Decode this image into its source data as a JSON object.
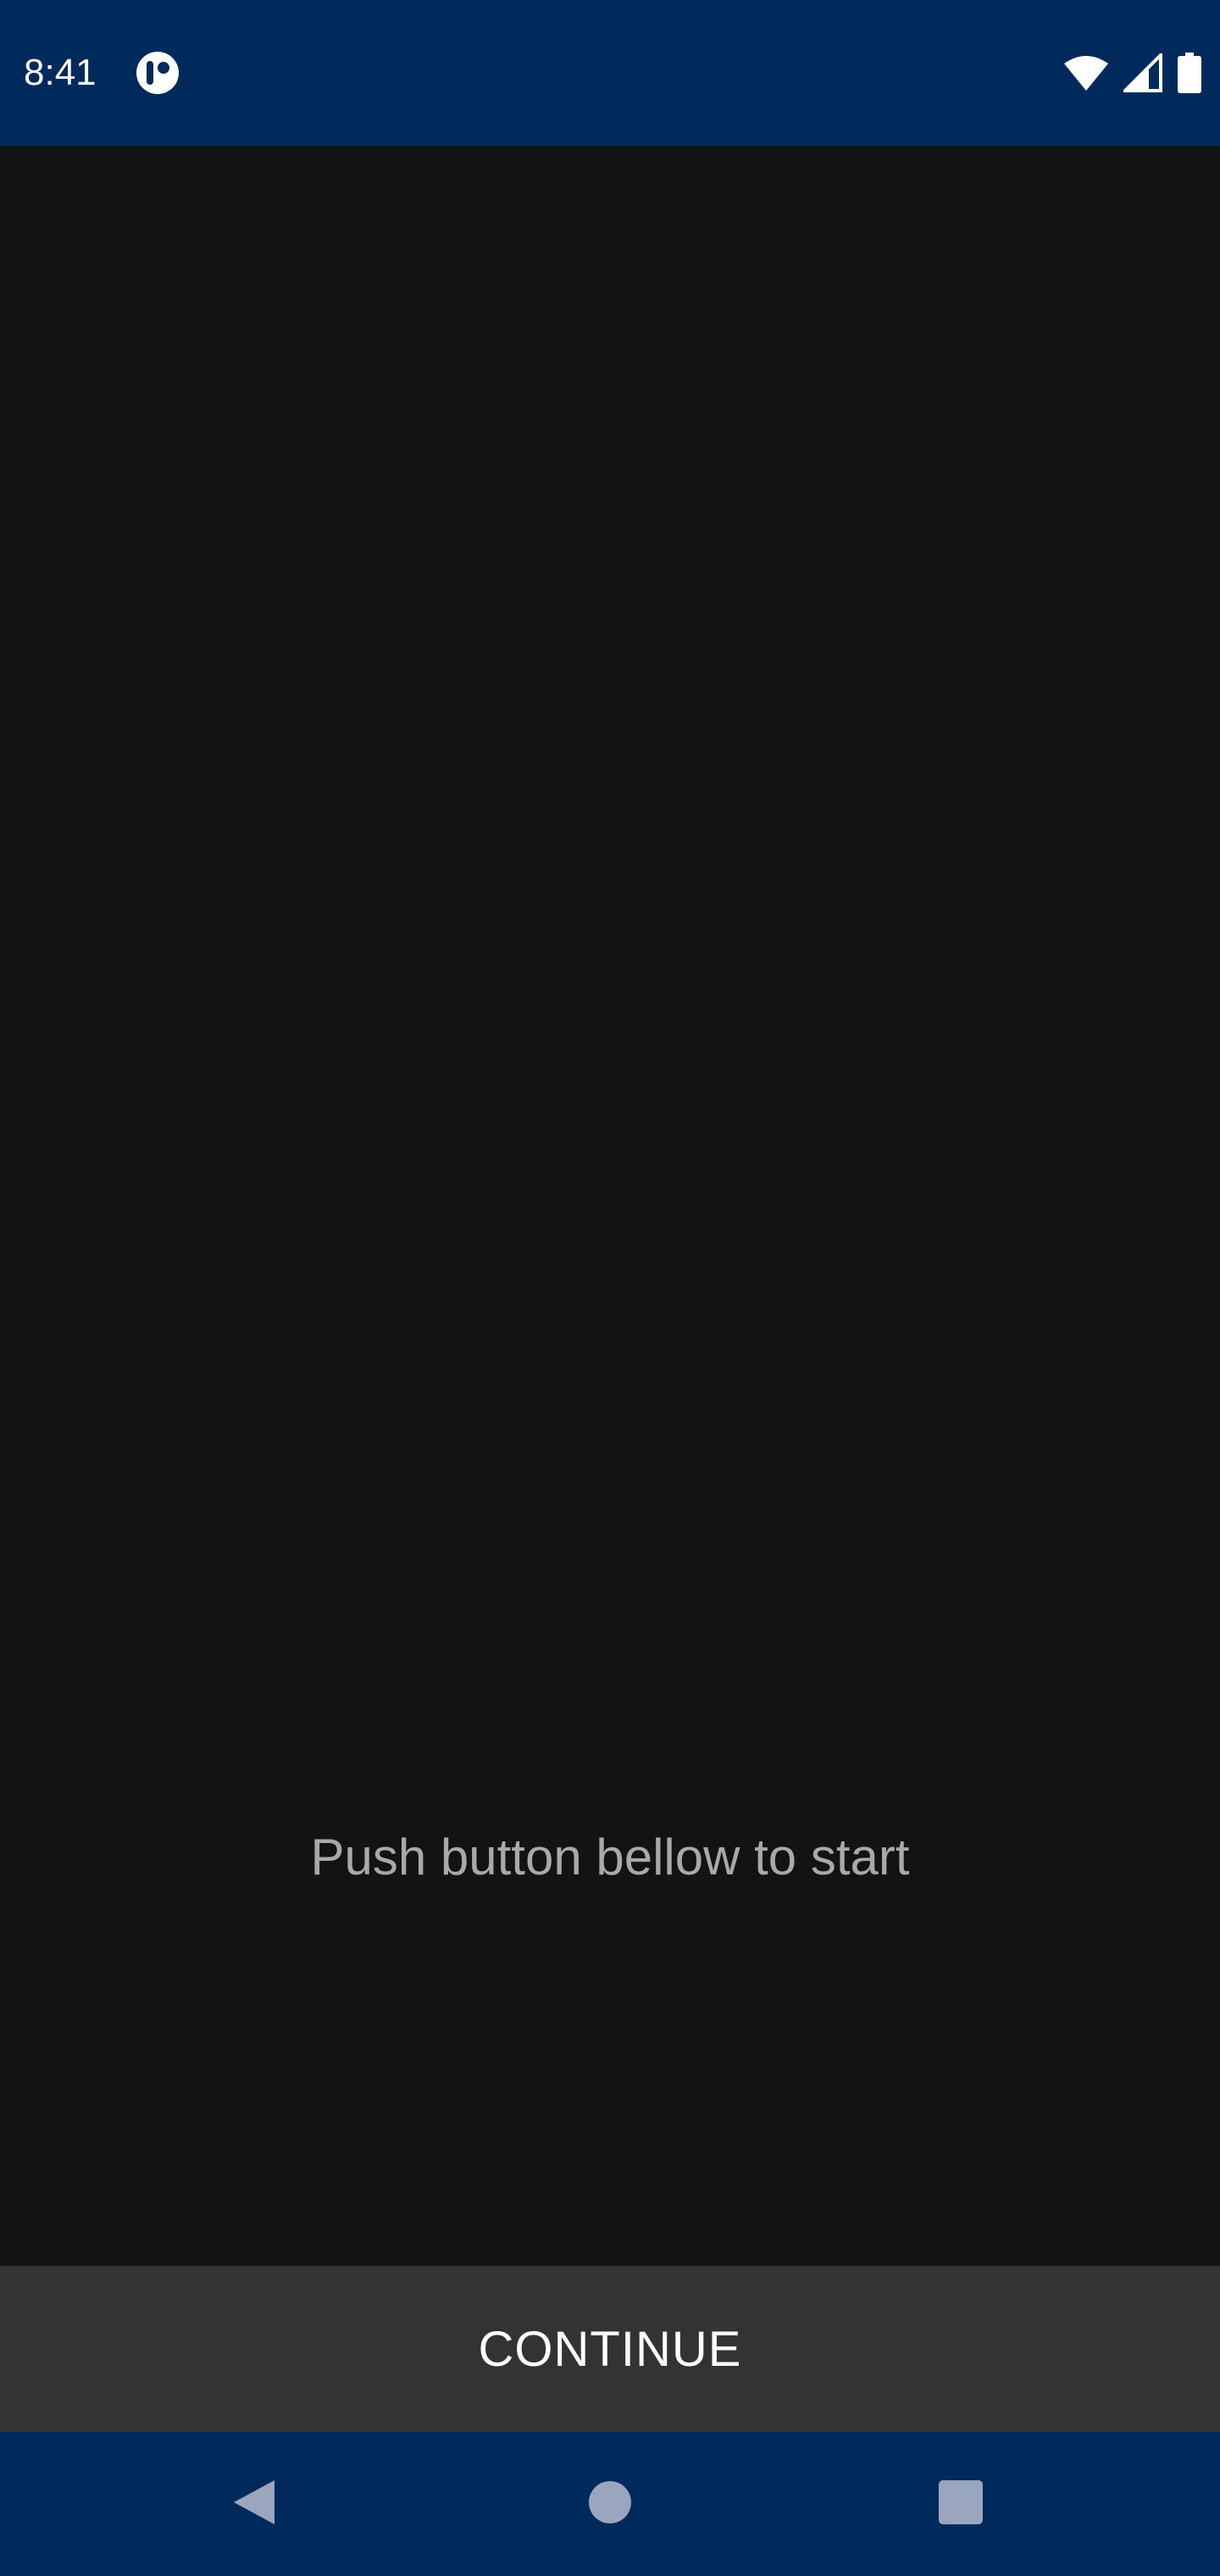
{
  "status_bar": {
    "time": "8:41",
    "icons": [
      "app-notification-icon",
      "wifi-icon",
      "cellular-signal-icon",
      "battery-icon"
    ]
  },
  "main": {
    "prompt": "Push button bellow to start"
  },
  "footer": {
    "continue_label": "CONTINUE"
  },
  "nav_bar": {
    "icons": [
      "back-icon",
      "home-icon",
      "recents-icon"
    ]
  },
  "colors": {
    "status_bar_bg": "#00295c",
    "content_bg": "#131313",
    "button_bg": "#333333",
    "prompt_text": "#a9a9a9",
    "nav_icon": "#9aa6bd"
  }
}
